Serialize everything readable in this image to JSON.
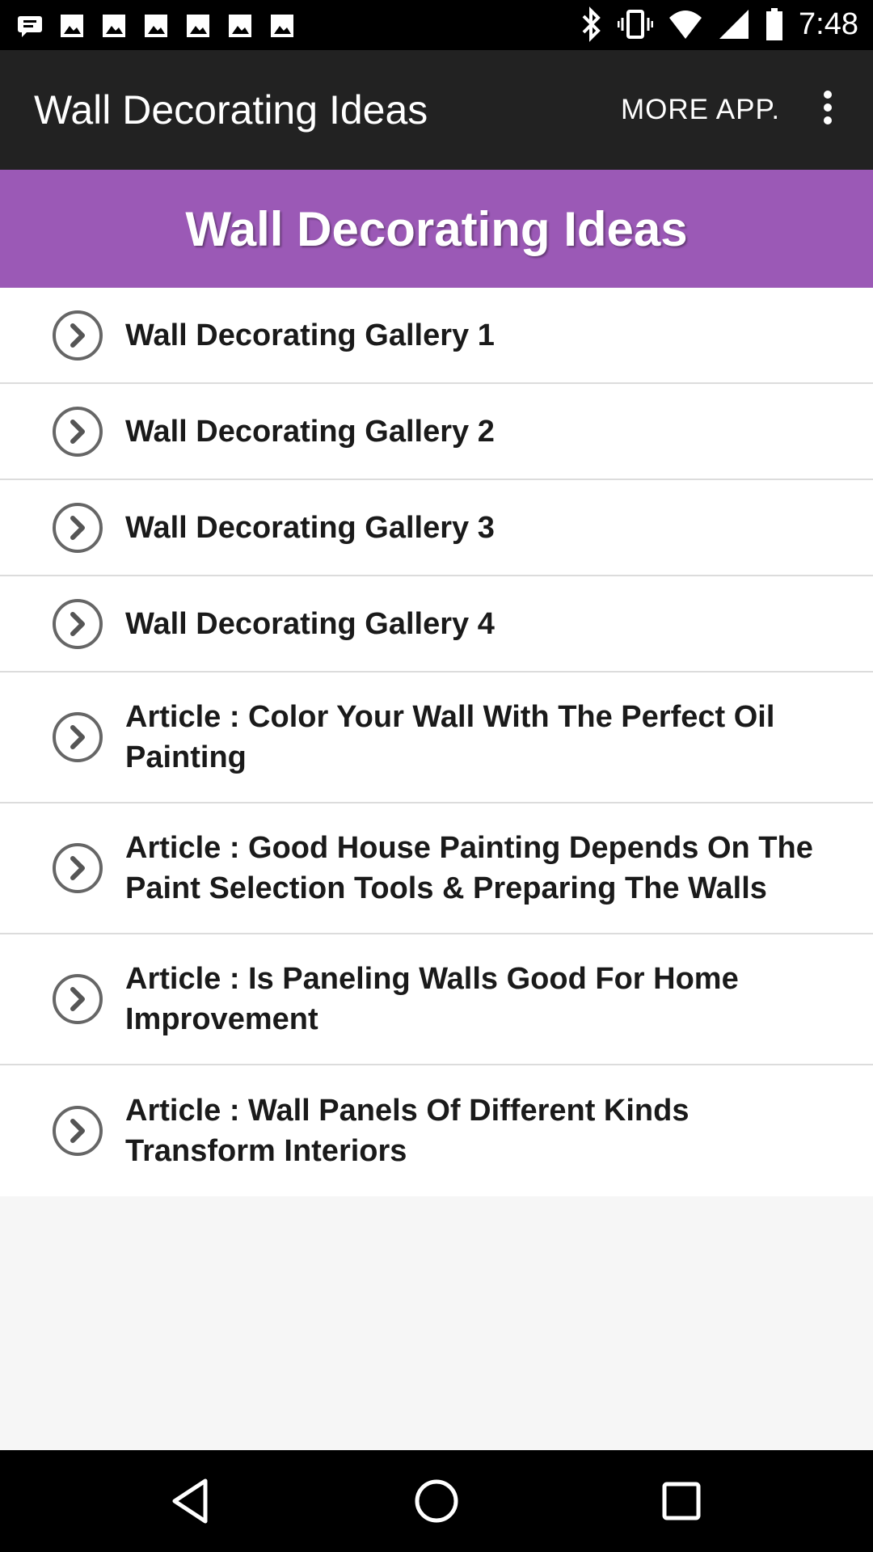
{
  "status_bar": {
    "time": "7:48",
    "notification_icons": [
      "message-icon",
      "image-icon",
      "image-icon",
      "image-icon",
      "image-icon",
      "image-icon",
      "image-icon"
    ],
    "system_icons": [
      "bluetooth-icon",
      "vibrate-icon",
      "wifi-icon",
      "signal-icon",
      "battery-icon"
    ]
  },
  "app_bar": {
    "title": "Wall Decorating Ideas",
    "more_app": "MORE APP.",
    "overflow_icon": "more-vert-icon"
  },
  "banner": {
    "title": "Wall Decorating Ideas",
    "color": "#9b59b6"
  },
  "list": {
    "items": [
      {
        "label": "Wall Decorating Gallery 1"
      },
      {
        "label": "Wall Decorating Gallery 2"
      },
      {
        "label": "Wall Decorating Gallery 3"
      },
      {
        "label": "Wall Decorating Gallery 4"
      },
      {
        "label": "Article : Color Your Wall With The Perfect Oil Painting"
      },
      {
        "label": "Article : Good House Painting Depends On The Paint Selection Tools & Preparing The Walls"
      },
      {
        "label": "Article : Is Paneling Walls Good For Home Improvement"
      },
      {
        "label": "Article : Wall Panels Of Different Kinds Transform Interiors"
      }
    ],
    "item_icon": "chevron-right-circle-icon"
  },
  "nav_bar": {
    "buttons": [
      "back-icon",
      "home-icon",
      "recents-icon"
    ]
  }
}
